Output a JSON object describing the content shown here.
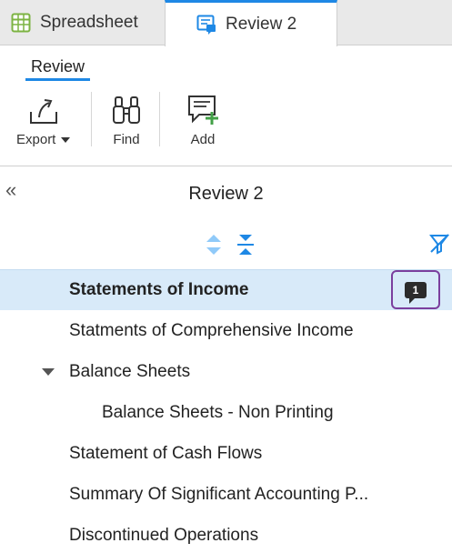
{
  "tabs": [
    {
      "label": "Spreadsheet",
      "icon": "spreadsheet-icon",
      "color": "#7cb342"
    },
    {
      "label": "Review 2",
      "icon": "review-icon",
      "color": "#1e88e5",
      "active": true
    }
  ],
  "ribbon": {
    "tab": "Review",
    "tools": [
      {
        "label": "Export",
        "icon": "export-icon"
      },
      {
        "label": "Find",
        "icon": "binoculars-icon"
      },
      {
        "label": "Add",
        "icon": "add-comment-icon"
      }
    ]
  },
  "panel": {
    "title": "Review 2",
    "collapse_icon": "«"
  },
  "tree": [
    {
      "label": "Statements of Income",
      "selected": true,
      "comments": "1"
    },
    {
      "label": "Statments of Comprehensive Income"
    },
    {
      "label": "Balance Sheets",
      "expanded": true
    },
    {
      "label": "Balance Sheets - Non Printing",
      "child": true
    },
    {
      "label": "Statement of Cash Flows"
    },
    {
      "label": "Summary Of Significant Accounting P..."
    },
    {
      "label": "Discontinued Operations"
    }
  ],
  "colors": {
    "accent": "#1e88e5",
    "selected_row": "#d8eaf9",
    "highlight": "#7b3f9e",
    "add_green": "#43a047"
  }
}
